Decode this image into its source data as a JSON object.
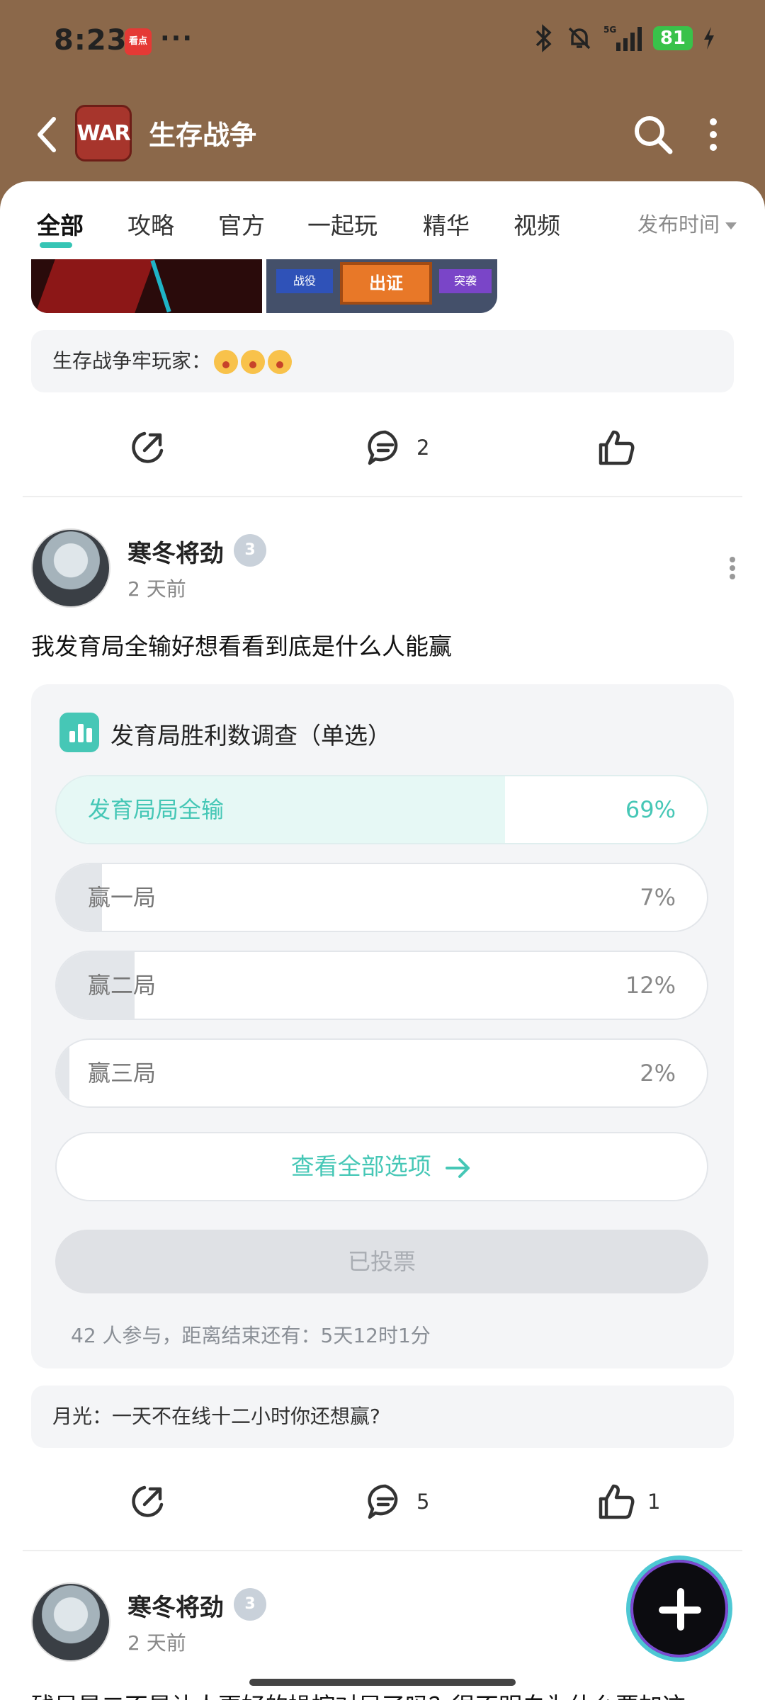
{
  "status_bar": {
    "time": "8:23",
    "app_badge": "看点",
    "dots": "···",
    "battery": "81",
    "icons": [
      "bluetooth-icon",
      "mute-icon",
      "5g-signal-icon",
      "charging-icon"
    ]
  },
  "header": {
    "title": "生存战争",
    "logo_text": "WAR"
  },
  "tabs": [
    {
      "label": "全部"
    },
    {
      "label": "攻略"
    },
    {
      "label": "官方"
    },
    {
      "label": "一起玩"
    },
    {
      "label": "精华"
    },
    {
      "label": "视频"
    }
  ],
  "sort_label": "发布时间",
  "prev_post": {
    "thumb2": {
      "left": "战役",
      "center": "出证",
      "right": "突袭"
    },
    "comment": "生存战争牢玩家：",
    "comment_count": "2",
    "like_count": ""
  },
  "post": {
    "author": "寒冬将劲",
    "level": "3",
    "time": "2 天前",
    "text": "我发育局全输好想看看到底是什么人能赢",
    "poll": {
      "title": "发育局胜利数调查（单选）",
      "options": [
        {
          "label": "发育局局全输",
          "percent_text": "69%",
          "percent": 69
        },
        {
          "label": "赢一局",
          "percent_text": "7%",
          "percent": 7
        },
        {
          "label": "赢二局",
          "percent_text": "12%",
          "percent": 12
        },
        {
          "label": "赢三局",
          "percent_text": "2%",
          "percent": 2
        }
      ],
      "view_all": "查看全部选项",
      "voted": "已投票",
      "meta": "42 人参与，距离结束还有：5天12时1分"
    },
    "comment": "月光：一天不在线十二小时你还想赢?",
    "comment_count": "5",
    "like_count": "1"
  },
  "next_post": {
    "author": "寒冬将劲",
    "level": "3",
    "time": "2 天前",
    "text": "残局是二不是让人更好的操控对局了吗？很不明白为什么要加这"
  },
  "colors": {
    "accent": "#46c7b6",
    "header_bg": "#8b684a"
  }
}
